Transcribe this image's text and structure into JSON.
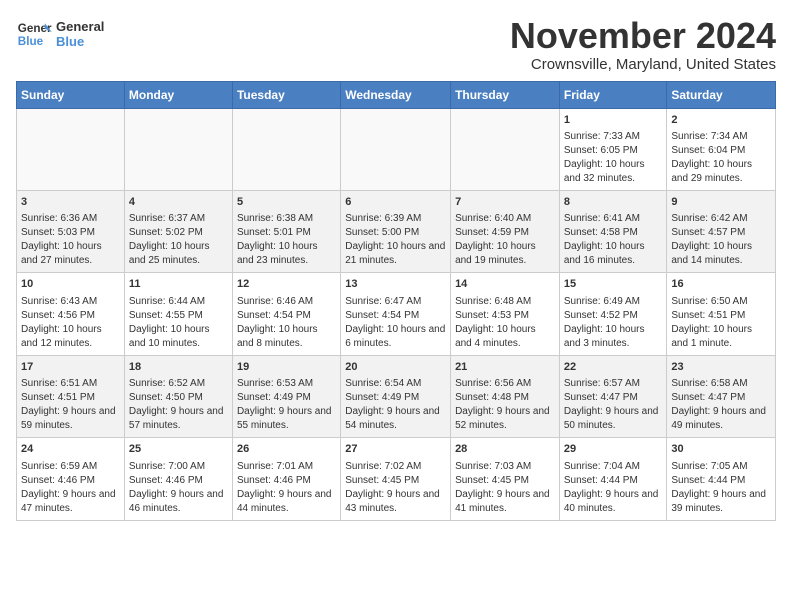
{
  "logo": {
    "line1": "General",
    "line2": "Blue"
  },
  "title": "November 2024",
  "location": "Crownsville, Maryland, United States",
  "days_of_week": [
    "Sunday",
    "Monday",
    "Tuesday",
    "Wednesday",
    "Thursday",
    "Friday",
    "Saturday"
  ],
  "weeks": [
    [
      {
        "day": "",
        "info": ""
      },
      {
        "day": "",
        "info": ""
      },
      {
        "day": "",
        "info": ""
      },
      {
        "day": "",
        "info": ""
      },
      {
        "day": "",
        "info": ""
      },
      {
        "day": "1",
        "info": "Sunrise: 7:33 AM\nSunset: 6:05 PM\nDaylight: 10 hours and 32 minutes."
      },
      {
        "day": "2",
        "info": "Sunrise: 7:34 AM\nSunset: 6:04 PM\nDaylight: 10 hours and 29 minutes."
      }
    ],
    [
      {
        "day": "3",
        "info": "Sunrise: 6:36 AM\nSunset: 5:03 PM\nDaylight: 10 hours and 27 minutes."
      },
      {
        "day": "4",
        "info": "Sunrise: 6:37 AM\nSunset: 5:02 PM\nDaylight: 10 hours and 25 minutes."
      },
      {
        "day": "5",
        "info": "Sunrise: 6:38 AM\nSunset: 5:01 PM\nDaylight: 10 hours and 23 minutes."
      },
      {
        "day": "6",
        "info": "Sunrise: 6:39 AM\nSunset: 5:00 PM\nDaylight: 10 hours and 21 minutes."
      },
      {
        "day": "7",
        "info": "Sunrise: 6:40 AM\nSunset: 4:59 PM\nDaylight: 10 hours and 19 minutes."
      },
      {
        "day": "8",
        "info": "Sunrise: 6:41 AM\nSunset: 4:58 PM\nDaylight: 10 hours and 16 minutes."
      },
      {
        "day": "9",
        "info": "Sunrise: 6:42 AM\nSunset: 4:57 PM\nDaylight: 10 hours and 14 minutes."
      }
    ],
    [
      {
        "day": "10",
        "info": "Sunrise: 6:43 AM\nSunset: 4:56 PM\nDaylight: 10 hours and 12 minutes."
      },
      {
        "day": "11",
        "info": "Sunrise: 6:44 AM\nSunset: 4:55 PM\nDaylight: 10 hours and 10 minutes."
      },
      {
        "day": "12",
        "info": "Sunrise: 6:46 AM\nSunset: 4:54 PM\nDaylight: 10 hours and 8 minutes."
      },
      {
        "day": "13",
        "info": "Sunrise: 6:47 AM\nSunset: 4:54 PM\nDaylight: 10 hours and 6 minutes."
      },
      {
        "day": "14",
        "info": "Sunrise: 6:48 AM\nSunset: 4:53 PM\nDaylight: 10 hours and 4 minutes."
      },
      {
        "day": "15",
        "info": "Sunrise: 6:49 AM\nSunset: 4:52 PM\nDaylight: 10 hours and 3 minutes."
      },
      {
        "day": "16",
        "info": "Sunrise: 6:50 AM\nSunset: 4:51 PM\nDaylight: 10 hours and 1 minute."
      }
    ],
    [
      {
        "day": "17",
        "info": "Sunrise: 6:51 AM\nSunset: 4:51 PM\nDaylight: 9 hours and 59 minutes."
      },
      {
        "day": "18",
        "info": "Sunrise: 6:52 AM\nSunset: 4:50 PM\nDaylight: 9 hours and 57 minutes."
      },
      {
        "day": "19",
        "info": "Sunrise: 6:53 AM\nSunset: 4:49 PM\nDaylight: 9 hours and 55 minutes."
      },
      {
        "day": "20",
        "info": "Sunrise: 6:54 AM\nSunset: 4:49 PM\nDaylight: 9 hours and 54 minutes."
      },
      {
        "day": "21",
        "info": "Sunrise: 6:56 AM\nSunset: 4:48 PM\nDaylight: 9 hours and 52 minutes."
      },
      {
        "day": "22",
        "info": "Sunrise: 6:57 AM\nSunset: 4:47 PM\nDaylight: 9 hours and 50 minutes."
      },
      {
        "day": "23",
        "info": "Sunrise: 6:58 AM\nSunset: 4:47 PM\nDaylight: 9 hours and 49 minutes."
      }
    ],
    [
      {
        "day": "24",
        "info": "Sunrise: 6:59 AM\nSunset: 4:46 PM\nDaylight: 9 hours and 47 minutes."
      },
      {
        "day": "25",
        "info": "Sunrise: 7:00 AM\nSunset: 4:46 PM\nDaylight: 9 hours and 46 minutes."
      },
      {
        "day": "26",
        "info": "Sunrise: 7:01 AM\nSunset: 4:46 PM\nDaylight: 9 hours and 44 minutes."
      },
      {
        "day": "27",
        "info": "Sunrise: 7:02 AM\nSunset: 4:45 PM\nDaylight: 9 hours and 43 minutes."
      },
      {
        "day": "28",
        "info": "Sunrise: 7:03 AM\nSunset: 4:45 PM\nDaylight: 9 hours and 41 minutes."
      },
      {
        "day": "29",
        "info": "Sunrise: 7:04 AM\nSunset: 4:44 PM\nDaylight: 9 hours and 40 minutes."
      },
      {
        "day": "30",
        "info": "Sunrise: 7:05 AM\nSunset: 4:44 PM\nDaylight: 9 hours and 39 minutes."
      }
    ]
  ]
}
